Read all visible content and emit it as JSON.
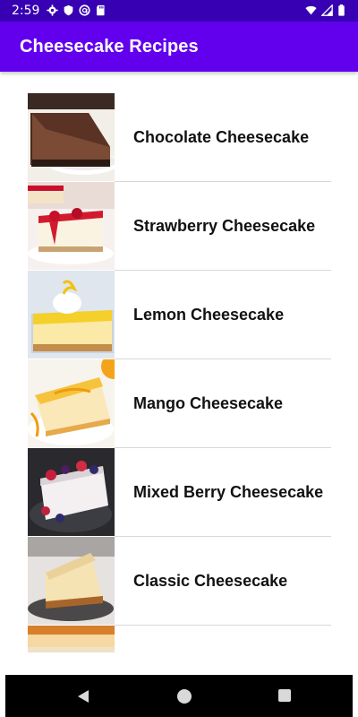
{
  "status_bar": {
    "time": "2:59",
    "icons_left": [
      "gear-icon",
      "shield-icon",
      "circle-a-icon",
      "sd-card-icon"
    ],
    "icons_right": [
      "wifi-icon",
      "signal-icon",
      "battery-icon"
    ]
  },
  "app_bar": {
    "title": "Cheesecake Recipes",
    "color": "#6200ee",
    "status_color": "#3700b3"
  },
  "recipes": [
    {
      "name": "Chocolate Cheesecake",
      "thumb": "chocolate-cheesecake-photo"
    },
    {
      "name": "Strawberry Cheesecake",
      "thumb": "strawberry-cheesecake-photo"
    },
    {
      "name": "Lemon Cheesecake",
      "thumb": "lemon-cheesecake-photo"
    },
    {
      "name": "Mango Cheesecake",
      "thumb": "mango-cheesecake-photo"
    },
    {
      "name": "Mixed Berry Cheesecake",
      "thumb": "mixed-berry-cheesecake-photo"
    },
    {
      "name": "Classic Cheesecake",
      "thumb": "classic-cheesecake-photo"
    },
    {
      "name": "",
      "thumb": "partial-cheesecake-photo"
    }
  ],
  "nav_bar": {
    "icons": [
      "back-icon",
      "home-icon",
      "recents-icon"
    ]
  }
}
